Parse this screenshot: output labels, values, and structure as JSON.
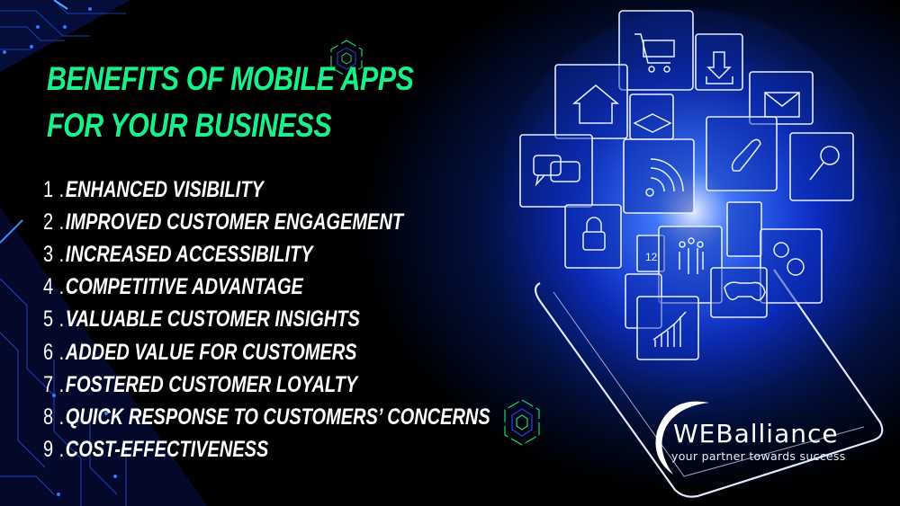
{
  "title": "Benefits of Mobile Apps for Your Business",
  "benefits": [
    {
      "number": "1",
      "label": "Enhanced Visibility"
    },
    {
      "number": "2",
      "label": "Improved Customer Engagement"
    },
    {
      "number": "3",
      "label": "Increased Accessibility"
    },
    {
      "number": "4",
      "label": "Competitive Advantage"
    },
    {
      "number": "5",
      "label": "Valuable Customer Insights"
    },
    {
      "number": "6",
      "label": "Added Value for Customers"
    },
    {
      "number": "7",
      "label": "Fostered Customer Loyalty"
    },
    {
      "number": "8",
      "label": "Quick Response to Customers’ Concerns"
    },
    {
      "number": "9",
      "label": "Cost-Effectiveness"
    }
  ],
  "logo": {
    "name_prefix": "WEB",
    "name_suffix": "alliance",
    "tagline": "your partner towards success"
  },
  "app_icons": [
    "shopping-cart",
    "download",
    "home",
    "graduation-cap",
    "envelope",
    "chat",
    "wifi",
    "phone",
    "search",
    "lock",
    "calendar-12",
    "team",
    "music",
    "gears",
    "location-pin",
    "gamepad",
    "growth-chart"
  ],
  "colors": {
    "title": "#19f08a",
    "text": "#ffffff",
    "glow": "#0a3cff",
    "background": "#000000"
  }
}
